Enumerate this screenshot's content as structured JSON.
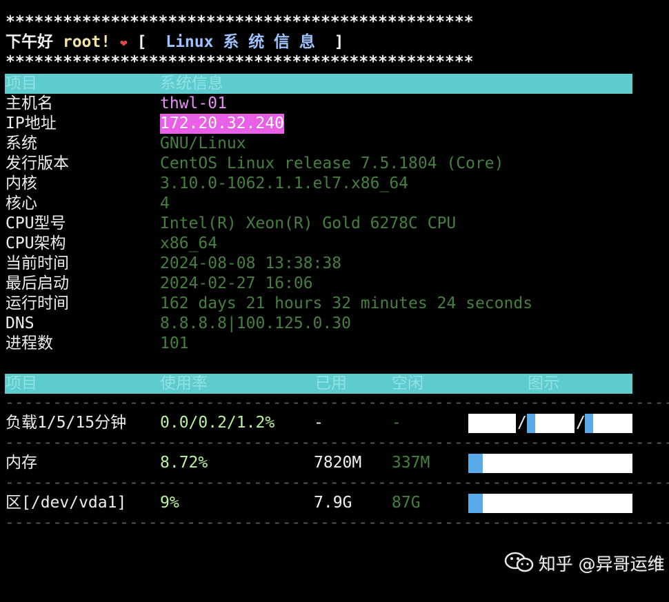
{
  "banner": {
    "stars": "*************************************************",
    "greeting": "下午好",
    "user": "root!",
    "heart": "❤",
    "open_bracket": "[",
    "title_latin": "Linux",
    "title_cn": "系 统 信 息",
    "close_bracket": "]"
  },
  "info_header": {
    "col1": "项目",
    "col2": "系统信息"
  },
  "info_rows": [
    {
      "label": "主机名",
      "value": "thwl-01"
    },
    {
      "label": "IP地址",
      "value": "172.20.32.240"
    },
    {
      "label": "系统",
      "value": "GNU/Linux"
    },
    {
      "label": "发行版本",
      "value": "CentOS Linux release 7.5.1804 (Core)"
    },
    {
      "label": "内核",
      "value": "3.10.0-1062.1.1.el7.x86_64"
    },
    {
      "label": "核心",
      "value": "4"
    },
    {
      "label": "CPU型号",
      "value": "Intel(R) Xeon(R) Gold 6278C CPU"
    },
    {
      "label": "CPU架构",
      "value": "x86_64"
    },
    {
      "label": "当前时间",
      "value": "2024-08-08 13:38:38"
    },
    {
      "label": "最后启动",
      "value": "2024-02-27 16:06"
    },
    {
      "label": "运行时间",
      "value": "162 days 21 hours 32 minutes 24 seconds"
    },
    {
      "label": "DNS",
      "value": "8.8.8.8|100.125.0.30"
    },
    {
      "label": "进程数",
      "value": "101"
    }
  ],
  "usage_header": {
    "item": "项目",
    "rate": "使用率",
    "used": "已用",
    "free": "空闲",
    "chart": "图示"
  },
  "dash_line": "-------------------------------------------------------------------------",
  "usage_rows": [
    {
      "label": "负载1/5/15分钟",
      "rate": "0.0/0.2/1.2%",
      "used": "-",
      "free": "-",
      "fills": [
        0.0,
        0.002,
        0.012
      ],
      "separator": "/"
    },
    {
      "label": "内存",
      "rate": "8.72%",
      "used": "7820M",
      "free": "337M",
      "fill": 0.0872
    },
    {
      "label": "区[/dev/vda1]",
      "rate": "9%",
      "used": "7.9G",
      "free": "87G",
      "fill": 0.09
    }
  ],
  "watermark": {
    "text": "知乎 @异哥运维",
    "icon": "wechat-icon"
  },
  "colors": {
    "header_bg": "#5ecbcc",
    "value_green": "#45803f",
    "bar_fill": "#5aa9e8",
    "ip_highlight": "#e95fe6"
  }
}
